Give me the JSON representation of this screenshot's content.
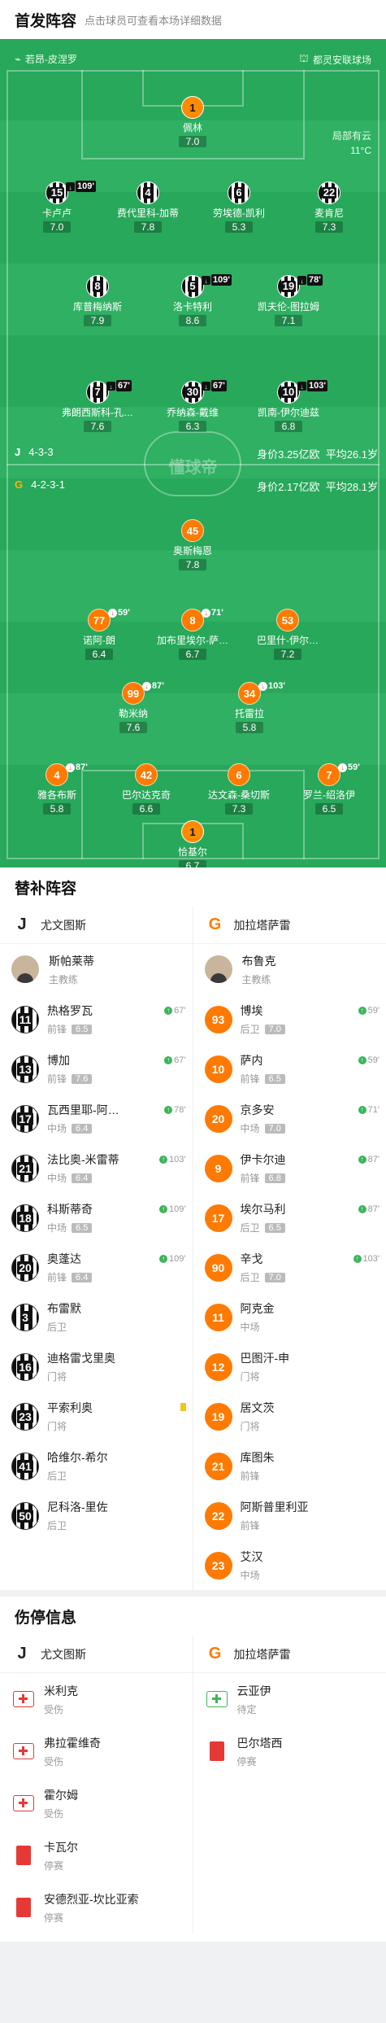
{
  "lineup": {
    "title": "首发阵容",
    "hint": "点击球员可查看本场详细数据"
  },
  "venue": {
    "home_coach_label": "若昂-皮涅罗",
    "stadium": "都灵安联球场"
  },
  "weather": {
    "desc": "局部有云",
    "temp": "11°C"
  },
  "watermark": "懂球帝",
  "juve_info": {
    "formation": "4-3-3",
    "value": "身价3.25亿欧",
    "age": "平均26.1岁"
  },
  "gal_info": {
    "formation": "4-2-3-1",
    "value": "身价2.17亿欧",
    "age": "平均28.1岁"
  },
  "juve_players": [
    {
      "num": "1",
      "name": "佩林",
      "rating": "7.0",
      "kit": "gk"
    },
    {
      "num": "15",
      "name": "卡卢卢",
      "rating": "7.0",
      "ev": "109'"
    },
    {
      "num": "4",
      "name": "费代里科-加蒂",
      "rating": "7.8"
    },
    {
      "num": "6",
      "name": "劳埃德-凯利",
      "rating": "5.3"
    },
    {
      "num": "22",
      "name": "麦肯尼",
      "rating": "7.3"
    },
    {
      "num": "8",
      "name": "库普梅纳斯",
      "rating": "7.9"
    },
    {
      "num": "5",
      "name": "洛卡特利",
      "rating": "8.6",
      "ev": "109'"
    },
    {
      "num": "19",
      "name": "凯夫伦-图拉姆",
      "rating": "7.1",
      "ev": "78'"
    },
    {
      "num": "7",
      "name": "弗朗西斯科-孔…",
      "rating": "7.6",
      "ev": "67'"
    },
    {
      "num": "30",
      "name": "乔纳森-戴维",
      "rating": "6.3",
      "ev": "67'"
    },
    {
      "num": "10",
      "name": "凯南-伊尔迪兹",
      "rating": "6.8",
      "ev": "103'"
    }
  ],
  "gal_players": [
    {
      "num": "45",
      "name": "奥斯梅恩",
      "rating": "7.8"
    },
    {
      "num": "77",
      "name": "诺阿-朗",
      "rating": "6.4",
      "ev": "59'"
    },
    {
      "num": "8",
      "name": "加布里埃尔-萨…",
      "rating": "6.7",
      "ev": "71'"
    },
    {
      "num": "53",
      "name": "巴里什-伊尔…",
      "rating": "7.2"
    },
    {
      "num": "99",
      "name": "勒米纳",
      "rating": "7.6",
      "ev": "87'"
    },
    {
      "num": "34",
      "name": "托雷拉",
      "rating": "5.8",
      "ev": "103'"
    },
    {
      "num": "4",
      "name": "雅各布斯",
      "rating": "5.8",
      "ev": "87'"
    },
    {
      "num": "42",
      "name": "巴尔达克奇",
      "rating": "6.6"
    },
    {
      "num": "6",
      "name": "达文森-桑切斯",
      "rating": "7.3"
    },
    {
      "num": "7",
      "name": "罗兰-绍洛伊",
      "rating": "6.5",
      "ev": "59'"
    },
    {
      "num": "1",
      "name": "恰基尔",
      "rating": "6.7",
      "kit": "gk"
    }
  ],
  "subs": {
    "title": "替补阵容",
    "home_team": "尤文图斯",
    "away_team": "加拉塔萨雷",
    "home_coach": {
      "name": "斯帕莱蒂",
      "role": "主教练"
    },
    "away_coach": {
      "name": "布鲁克",
      "role": "主教练"
    },
    "home": [
      {
        "num": "11",
        "name": "热格罗瓦",
        "pos": "前锋",
        "rating": "6.5",
        "ev": "67'"
      },
      {
        "num": "13",
        "name": "博加",
        "pos": "前锋",
        "rating": "7.6",
        "ev": "67'"
      },
      {
        "num": "17",
        "name": "瓦西里耶-阿…",
        "pos": "中场",
        "rating": "6.4",
        "ev": "78'"
      },
      {
        "num": "21",
        "name": "法比奥-米雷蒂",
        "pos": "中场",
        "rating": "6.4",
        "ev": "103'"
      },
      {
        "num": "18",
        "name": "科斯蒂奇",
        "pos": "中场",
        "rating": "6.5",
        "ev": "109'"
      },
      {
        "num": "20",
        "name": "奥蓬达",
        "pos": "前锋",
        "rating": "6.4",
        "ev": "109'"
      },
      {
        "num": "3",
        "name": "布雷默",
        "pos": "后卫"
      },
      {
        "num": "16",
        "name": "迪格雷戈里奥",
        "pos": "门将"
      },
      {
        "num": "23",
        "name": "平索利奥",
        "pos": "门将",
        "card": "y"
      },
      {
        "num": "41",
        "name": "哈维尔-希尔",
        "pos": "后卫"
      },
      {
        "num": "50",
        "name": "尼科洛-里佐",
        "pos": "后卫"
      }
    ],
    "away": [
      {
        "num": "93",
        "name": "博埃",
        "pos": "后卫",
        "rating": "7.0",
        "ev": "59'"
      },
      {
        "num": "10",
        "name": "萨内",
        "pos": "前锋",
        "rating": "6.5",
        "ev": "59'"
      },
      {
        "num": "20",
        "name": "京多安",
        "pos": "中场",
        "rating": "7.0",
        "ev": "71'"
      },
      {
        "num": "9",
        "name": "伊卡尔迪",
        "pos": "前锋",
        "rating": "6.8",
        "ev": "87'"
      },
      {
        "num": "17",
        "name": "埃尔马利",
        "pos": "后卫",
        "rating": "6.5",
        "ev": "87'"
      },
      {
        "num": "90",
        "name": "辛戈",
        "pos": "后卫",
        "rating": "7.0",
        "ev": "103'"
      },
      {
        "num": "11",
        "name": "阿克金",
        "pos": "中场"
      },
      {
        "num": "12",
        "name": "巴图汗-申",
        "pos": "门将"
      },
      {
        "num": "19",
        "name": "居文茨",
        "pos": "门将"
      },
      {
        "num": "21",
        "name": "库图朱",
        "pos": "前锋"
      },
      {
        "num": "22",
        "name": "阿斯普里利亚",
        "pos": "前锋"
      },
      {
        "num": "23",
        "name": "艾汉",
        "pos": "中场"
      }
    ]
  },
  "injury": {
    "title": "伤停信息",
    "home_team": "尤文图斯",
    "away_team": "加拉塔萨雷",
    "home": [
      {
        "name": "米利克",
        "status": "受伤",
        "icon": "med"
      },
      {
        "name": "弗拉霍维奇",
        "status": "受伤",
        "icon": "med"
      },
      {
        "name": "霍尔姆",
        "status": "受伤",
        "icon": "med"
      },
      {
        "name": "卡瓦尔",
        "status": "停赛",
        "icon": "red"
      },
      {
        "name": "安德烈亚-坎比亚索",
        "status": "停赛",
        "icon": "red"
      }
    ],
    "away": [
      {
        "name": "云亚伊",
        "status": "待定",
        "icon": "medg"
      },
      {
        "name": "巴尔塔西",
        "status": "停赛",
        "icon": "red"
      }
    ]
  }
}
